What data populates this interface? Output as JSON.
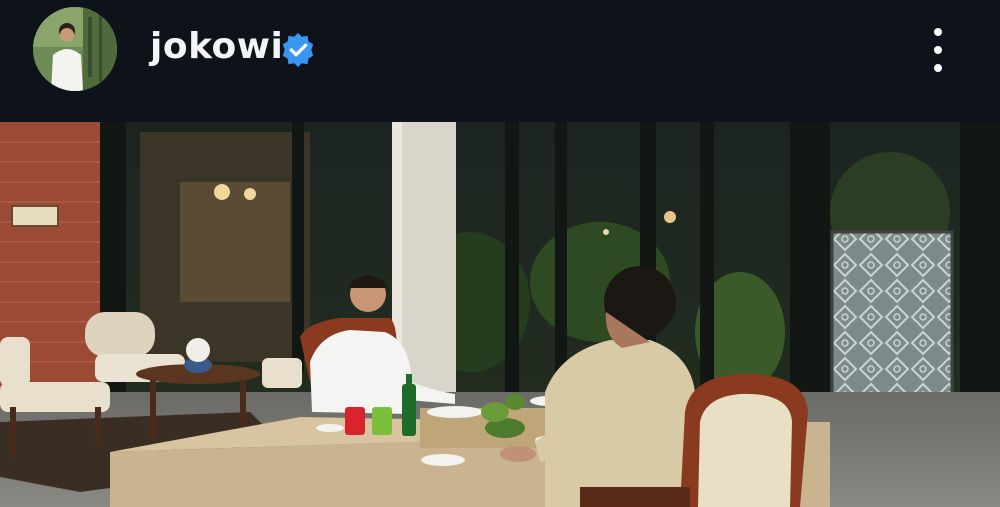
{
  "profile": {
    "username": "jokowi",
    "verified": true,
    "avatar_icon": "profile-avatar",
    "verified_icon": "verified-badge-icon",
    "menu_icon": "more-vertical-icon"
  },
  "colors": {
    "header_bg": "#0d121b",
    "verified_blue": "#3897f0",
    "text": "#f2f4f7"
  },
  "post": {
    "image_icon": "post-photo"
  }
}
